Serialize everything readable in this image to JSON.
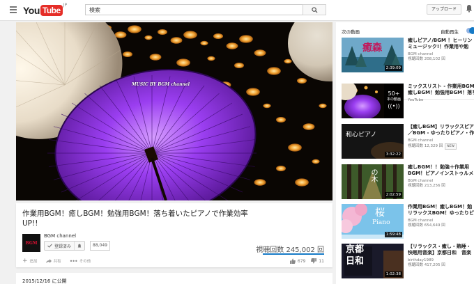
{
  "masthead": {
    "logo_you": "You",
    "logo_tube": "Tube",
    "logo_region": "JP",
    "search_value": "検索",
    "upload_label": "アップロード"
  },
  "video": {
    "watermark": "MUSIC BY BGM channel",
    "title_line1": "作業用BGM！癒しBGM！勉強用BGM！落ち着いたピアノで作業効率",
    "title_line2": "UP!!",
    "channel_name": "BGM channel",
    "channel_avatar_text": "BGM",
    "subscribed_label": "登録済み",
    "subscriber_count": "88,049",
    "views": "視聴回数 245,002 回",
    "add_label": "追加",
    "share_label": "共有",
    "more_label": "その他",
    "likes": "679",
    "dislikes": "11",
    "published": "2015/12/16 に公開"
  },
  "sidebar": {
    "up_next_label": "次の動画",
    "autoplay_label": "自動再生",
    "items": [
      {
        "title1": "癒しピアノ/BGM ！ヒーリン",
        "title2": "ミュージック!！作業用や勉",
        "channel": "BGM channel",
        "views": "視聴回数 208,102 回",
        "duration": "2:39:09",
        "thumb_text": "癒森"
      },
      {
        "title1": "ミックスリスト - 作業用BGM",
        "title2": "癒しBGM！勉強用BGM！落ち",
        "channel": "YouTube",
        "views": "",
        "playlist_count": "50+",
        "playlist_label": "本の動画"
      },
      {
        "title1": "【癒しBGM】リラックスピア",
        "title2": "／BGM - ゆったりピアノ・作",
        "channel": "BGM channel",
        "views": "視聴回数 12,329 回",
        "badge": "NEW",
        "duration": "3:32:22",
        "thumb_text": "和心ピアノ"
      },
      {
        "title1": "癒しBGM！！勉強＋作業用",
        "title2": "BGM！ピアノインストゥルメ",
        "channel": "BGM channel",
        "views": "視聴回数 213,256 回",
        "duration": "2:02:59",
        "thumb_text": "の木"
      },
      {
        "title1": "作業用BGM！癒しBGM！勉",
        "title2": "リラックスBGM！ゆったりピ",
        "channel": "BGM channel",
        "views": "視聴回数 654,649 回",
        "duration": "1:59:48",
        "thumb_text": "桜",
        "thumb_sub": "Piano"
      },
      {
        "title1": "【リラックス・癒し・熟睡・",
        "title2": "快眠用音楽】京都日和　音楽",
        "channel": "birthday1989",
        "views": "視聴回数 417,205 回",
        "duration": "1:02:38",
        "thumb_text": "京都",
        "thumb_sub": "日和"
      }
    ]
  },
  "colors": {
    "accent": "#167ac6",
    "brand_red": "#e52d27",
    "umbrella_purple": "#8a2bd6"
  }
}
